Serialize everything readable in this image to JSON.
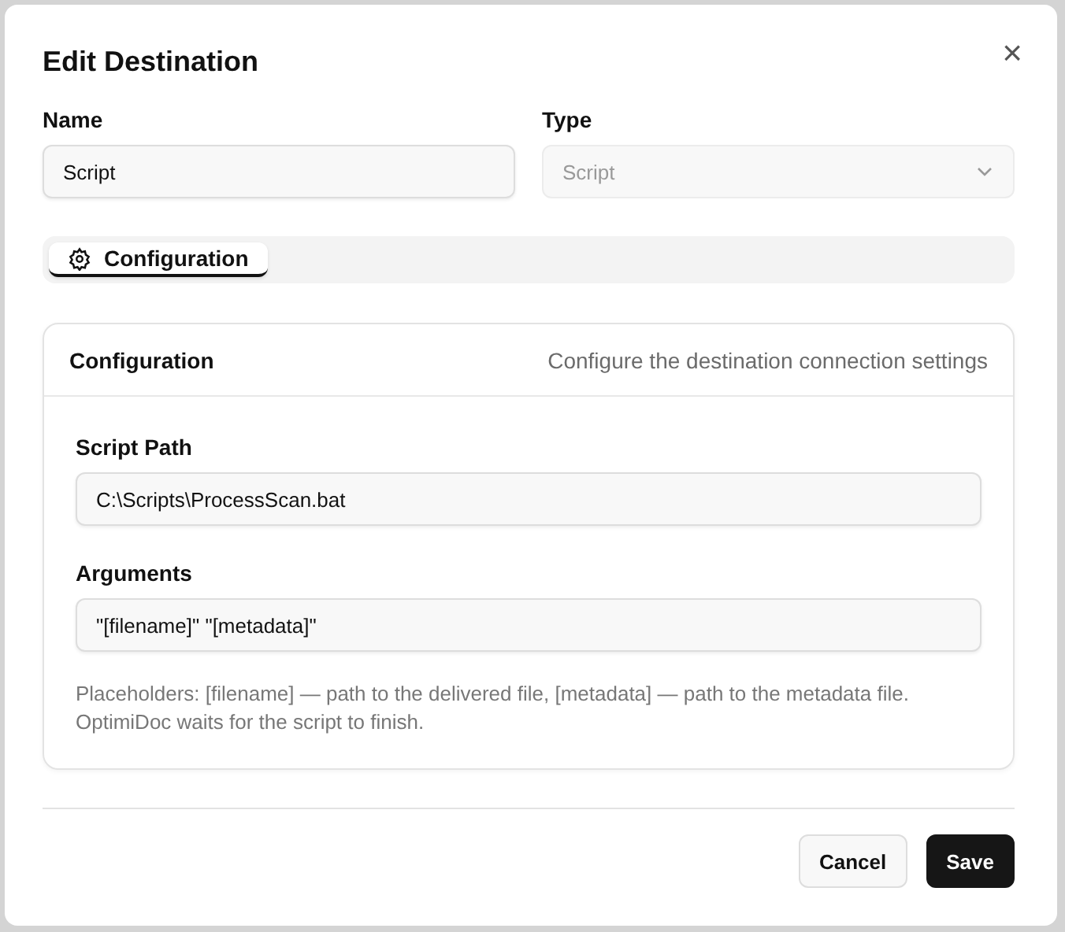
{
  "dialog": {
    "title": "Edit Destination",
    "close_icon": "×"
  },
  "fields": [
    {
      "label": "Name",
      "value": "Script",
      "kind": "text",
      "disabled": false
    },
    {
      "label": "Type",
      "value": "Script",
      "kind": "select",
      "disabled": true
    }
  ],
  "tabs": [
    {
      "label": "Configuration",
      "selected": true
    }
  ],
  "card": {
    "title": "Configuration",
    "subtitle": "Configure the destination connection settings",
    "fields": [
      {
        "label": "Script Path",
        "value": "C:\\Scripts\\ProcessScan.bat"
      },
      {
        "label": "Arguments",
        "value": "\"[filename]\" \"[metadata]\""
      }
    ],
    "help": "Placeholders: [filename] — path to the delivered file, [metadata] — path to the metadata file. OptimiDoc waits for the script to finish."
  },
  "buttons": [
    {
      "label": "Cancel",
      "kind": "secondary"
    },
    {
      "label": "Save",
      "kind": "primary"
    }
  ]
}
